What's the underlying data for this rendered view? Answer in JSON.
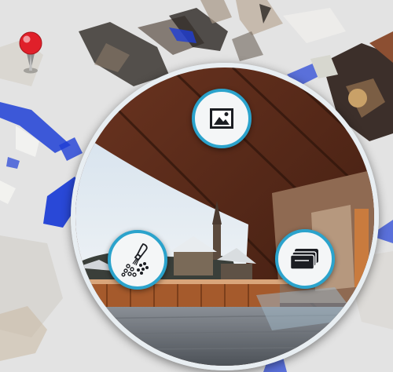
{
  "map": {
    "background_color": "#e3e3e3",
    "pointcloud_accent_color": "#1f3fd6",
    "pin_color": "#e0202a",
    "pin_icon": "location-pin-icon"
  },
  "lens": {
    "ring_color": "#e8eef2",
    "sky_color": "#dfe9f2",
    "wood_color": "#5a2b1a"
  },
  "actions": {
    "accent_color": "#2ba3cc",
    "view_mode": {
      "icon": "image-frame-icon",
      "label": ""
    },
    "filters": {
      "icon": "brush-dots-icon",
      "label": ""
    },
    "info": {
      "icon": "stacked-cards-icon",
      "label": ""
    }
  }
}
